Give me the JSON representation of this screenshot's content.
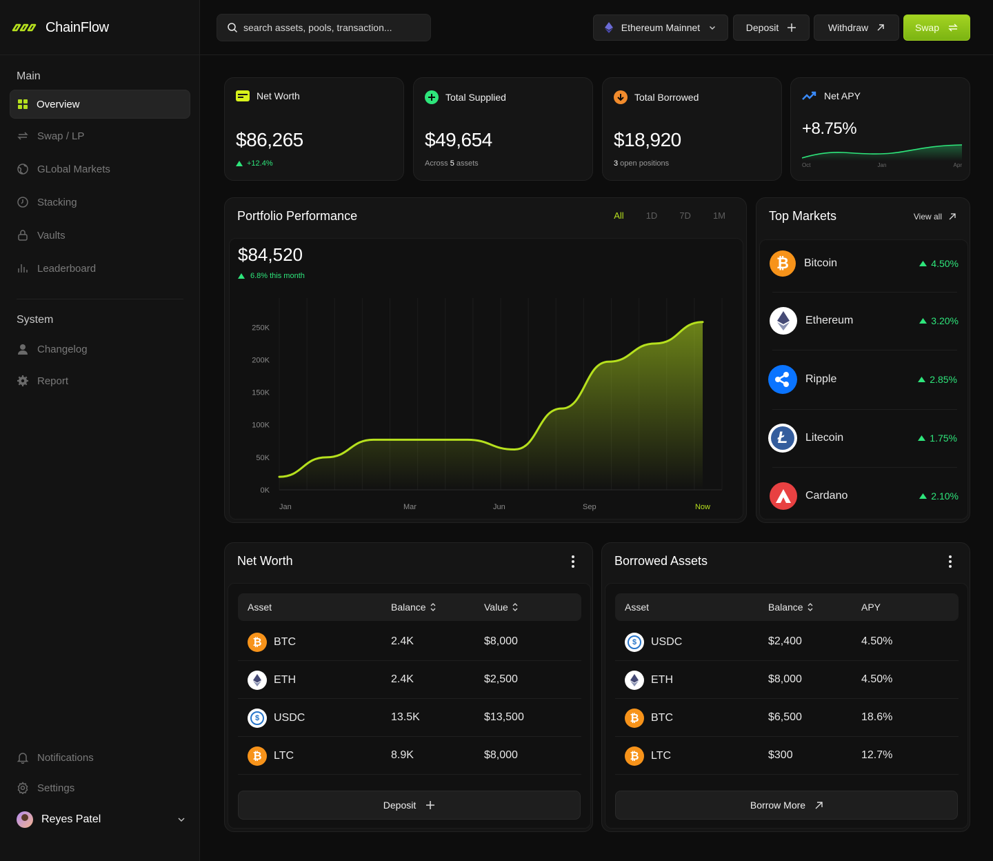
{
  "brand": {
    "name": "ChainFlow",
    "accent": "#b6e01e",
    "up_color": "#2ee57b"
  },
  "sidebar": {
    "main_label": "Main",
    "main_items": [
      {
        "label": "Overview",
        "icon": "grid-icon",
        "active": true
      },
      {
        "label": "Swap / LP",
        "icon": "swap-icon"
      },
      {
        "label": "GLobal Markets",
        "icon": "globe-icon"
      },
      {
        "label": "Stacking",
        "icon": "clock-icon"
      },
      {
        "label": "Vaults",
        "icon": "lock-icon"
      },
      {
        "label": "Leaderboard",
        "icon": "bar-chart-icon"
      }
    ],
    "system_label": "System",
    "system_items": [
      {
        "label": "Changelog",
        "icon": "user-icon"
      },
      {
        "label": "Report",
        "icon": "gear-badge-icon"
      }
    ],
    "bottom_items": [
      {
        "label": "Notifications",
        "icon": "bell-icon"
      },
      {
        "label": "Settings",
        "icon": "settings-icon"
      }
    ],
    "user": {
      "name": "Reyes Patel"
    }
  },
  "topbar": {
    "search_placeholder": "search assets, pools, transaction...",
    "network": "Ethereum Mainnet",
    "deposit": "Deposit",
    "withdraw": "Withdraw",
    "swap": "Swap"
  },
  "stats": [
    {
      "title": "Net Worth",
      "value": "$86,265",
      "sub": "+12.4%",
      "icon": "wallet-icon"
    },
    {
      "title": "Total Supplied",
      "value": "$49,654",
      "sub_pre": "Across ",
      "sub_num": "5",
      "sub_post": " assets",
      "icon": "plus-circle-icon"
    },
    {
      "title": "Total Borrowed",
      "value": "$18,920",
      "sub_num": "3",
      "sub_post": " open positions",
      "icon": "arrow-down-circle-icon"
    },
    {
      "title": "Net APY",
      "value": "+8.75%",
      "spark_labels": [
        "Oct",
        "Jan",
        "Apr"
      ],
      "icon": "trend-up-icon"
    }
  ],
  "portfolio": {
    "title": "Portfolio Performance",
    "tabs": [
      "All",
      "1D",
      "7D",
      "1M"
    ],
    "active_tab": "All",
    "value": "$84,520",
    "change": "6.8% this month"
  },
  "chart_data": {
    "type": "area",
    "title": "Portfolio Performance",
    "x_labels": [
      "Jan",
      "Mar",
      "Jun",
      "Sep",
      "Now"
    ],
    "y_ticks": [
      "0K",
      "50K",
      "100K",
      "150K",
      "200K",
      "250K"
    ],
    "ylim": [
      0,
      280000
    ],
    "grid": true,
    "series": [
      {
        "values": [
          20000,
          50000,
          77000,
          77000,
          77000,
          62000,
          125000,
          197000,
          225000,
          258000
        ]
      }
    ]
  },
  "markets": {
    "title": "Top Markets",
    "view_all": "View all",
    "items": [
      {
        "name": "Bitcoin",
        "change": "4.50%",
        "color": "#f7931a",
        "icon": "bitcoin-icon"
      },
      {
        "name": "Ethereum",
        "change": "3.20%",
        "color": "#ffffff",
        "icon": "ethereum-icon"
      },
      {
        "name": "Ripple",
        "change": "2.85%",
        "color": "#0a74ff",
        "icon": "ripple-icon"
      },
      {
        "name": "Litecoin",
        "change": "1.75%",
        "color": "#ffffff",
        "icon": "litecoin-icon"
      },
      {
        "name": "Cardano",
        "change": "2.10%",
        "color": "#e84142",
        "icon": "cardano-icon"
      }
    ]
  },
  "networth_table": {
    "title": "Net Worth",
    "columns": [
      "Asset",
      "Balance",
      "Value"
    ],
    "rows": [
      {
        "asset": "BTC",
        "balance": "2.4K",
        "value": "$8,000",
        "icon": "btc"
      },
      {
        "asset": "ETH",
        "balance": "2.4K",
        "value": "$2,500",
        "icon": "eth"
      },
      {
        "asset": "USDC",
        "balance": "13.5K",
        "value": "$13,500",
        "icon": "usdc"
      },
      {
        "asset": "LTC",
        "balance": "8.9K",
        "value": "$8,000",
        "icon": "btc"
      }
    ],
    "button": "Deposit"
  },
  "borrowed_table": {
    "title": "Borrowed Assets",
    "columns": [
      "Asset",
      "Balance",
      "APY"
    ],
    "rows": [
      {
        "asset": "USDC",
        "balance": "$2,400",
        "value": "4.50%",
        "icon": "usdc"
      },
      {
        "asset": "ETH",
        "balance": "$8,000",
        "value": "4.50%",
        "icon": "eth"
      },
      {
        "asset": "BTC",
        "balance": "$6,500",
        "value": "18.6%",
        "icon": "btc"
      },
      {
        "asset": "LTC",
        "balance": "$300",
        "value": "12.7%",
        "icon": "btc"
      }
    ],
    "button": "Borrow More"
  }
}
